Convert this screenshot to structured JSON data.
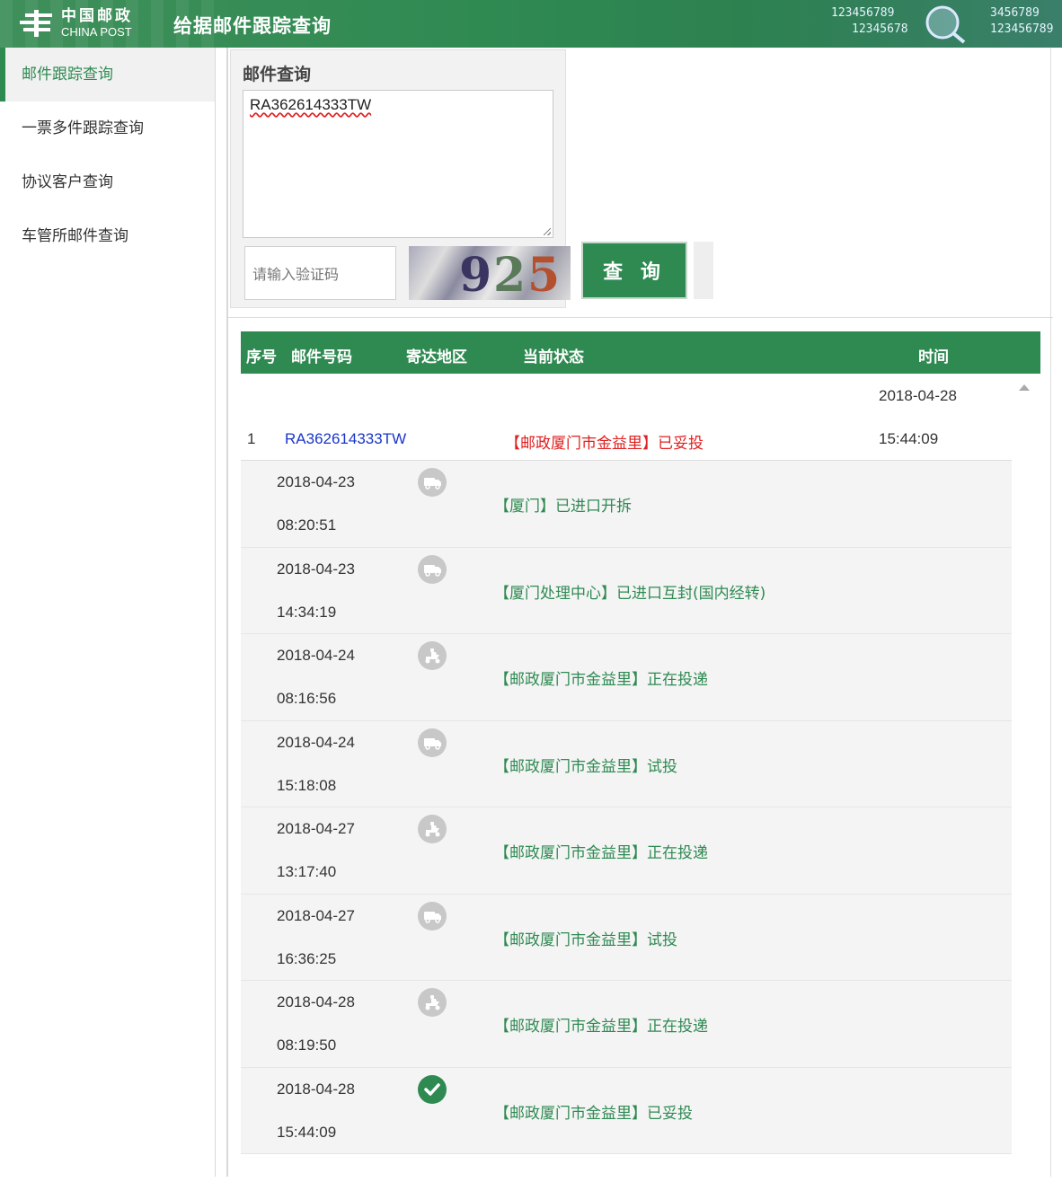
{
  "header": {
    "logo_cn": "中国邮政",
    "logo_en": "CHINA POST",
    "title": "给据邮件跟踪查询",
    "decor_digits": [
      "123456789",
      "12345678",
      "3456789",
      "123456789"
    ]
  },
  "sidebar": {
    "items": [
      {
        "label": "邮件跟踪查询",
        "active": true
      },
      {
        "label": "一票多件跟踪查询",
        "active": false
      },
      {
        "label": "协议客户查询",
        "active": false
      },
      {
        "label": "车管所邮件查询",
        "active": false
      }
    ]
  },
  "query": {
    "title": "邮件查询",
    "tracking_input_value": "RA362614333TW",
    "captcha_placeholder": "请输入验证码",
    "captcha_digits": [
      "9",
      "2",
      "5"
    ],
    "button_label": "查 询"
  },
  "table": {
    "headers": {
      "seq": "序号",
      "number": "邮件号码",
      "region": "寄达地区",
      "status": "当前状态",
      "time": "时间"
    },
    "summary": {
      "seq": "1",
      "number": "RA362614333TW",
      "status": "【邮政厦门市金益里】已妥投",
      "date": "2018-04-28",
      "time": "15:44:09"
    },
    "events": [
      {
        "date": "2018-04-23",
        "time": "08:20:51",
        "icon": "truck-icon",
        "status": "【厦门】已进口开拆"
      },
      {
        "date": "2018-04-23",
        "time": "14:34:19",
        "icon": "truck-icon",
        "status": "【厦门处理中心】已进口互封(国内经转)"
      },
      {
        "date": "2018-04-24",
        "time": "08:16:56",
        "icon": "courier-scooter-icon",
        "status": "【邮政厦门市金益里】正在投递"
      },
      {
        "date": "2018-04-24",
        "time": "15:18:08",
        "icon": "truck-icon",
        "status": "【邮政厦门市金益里】试投"
      },
      {
        "date": "2018-04-27",
        "time": "13:17:40",
        "icon": "courier-scooter-icon",
        "status": "【邮政厦门市金益里】正在投递"
      },
      {
        "date": "2018-04-27",
        "time": "16:36:25",
        "icon": "truck-icon",
        "status": "【邮政厦门市金益里】试投"
      },
      {
        "date": "2018-04-28",
        "time": "08:19:50",
        "icon": "courier-scooter-icon",
        "status": "【邮政厦门市金益里】正在投递"
      },
      {
        "date": "2018-04-28",
        "time": "15:44:09",
        "icon": "checkmark-icon",
        "status": "【邮政厦门市金益里】已妥投"
      }
    ]
  },
  "colors": {
    "brand_green": "#2f8a52",
    "delivered_red": "#e02020",
    "link_blue": "#1a35c8"
  }
}
